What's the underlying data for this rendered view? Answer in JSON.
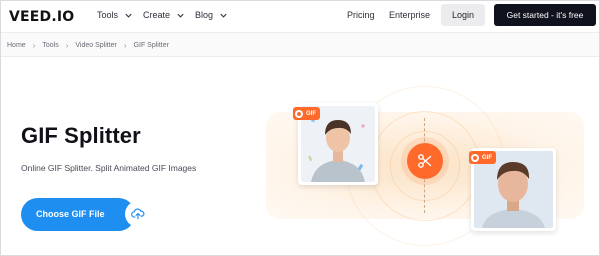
{
  "header": {
    "logo": "VEED.IO",
    "nav": [
      {
        "label": "Tools"
      },
      {
        "label": "Create"
      },
      {
        "label": "Blog"
      }
    ],
    "pricing": "Pricing",
    "enterprise": "Enterprise",
    "login": "Login",
    "cta": "Get started - it's free"
  },
  "breadcrumb": [
    "Home",
    "Tools",
    "Video Splitter",
    "GIF Splitter"
  ],
  "main": {
    "title": "GIF Splitter",
    "subtitle": "Online GIF Splitter. Split Animated GIF Images",
    "button_label": "Choose GIF File"
  },
  "illustration": {
    "tag_left": "GIF",
    "tag_right": "GIF"
  },
  "colors": {
    "accent_blue": "#1f8ef1",
    "accent_orange": "#ff6a2b",
    "dark_button": "#10121e"
  }
}
